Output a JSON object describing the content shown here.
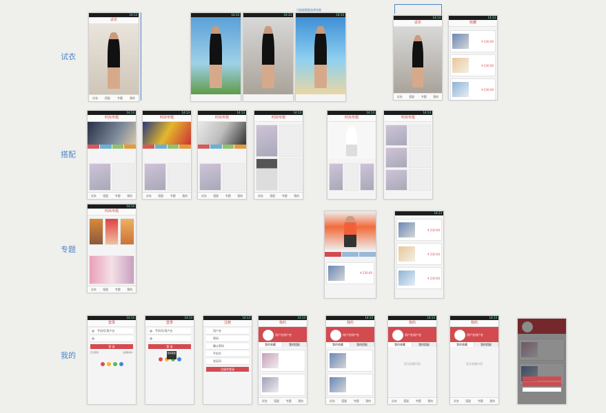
{
  "rows": [
    {
      "label": "试衣"
    },
    {
      "label": "搭配"
    },
    {
      "label": "专题"
    },
    {
      "label": "我的"
    }
  ],
  "statusbar": {
    "time": "14:13"
  },
  "tabbar": [
    "试衣",
    "搭配",
    "专题",
    "我的"
  ],
  "titles": {
    "tryon": "试衣",
    "fav": "收藏",
    "match": "时尚专题",
    "login": "登录",
    "register": "注册",
    "mine": "我的"
  },
  "notes": {
    "scene_switch": "可根据需要选择场景"
  },
  "login": {
    "user_placeholder": "手机号/用户名",
    "login_btn": "登 录",
    "forgot": "忘记密码",
    "register": "注册新用户",
    "toast": "密码错误"
  },
  "register": {
    "fields": [
      "用户名",
      "密码",
      "确认密码",
      "手机号",
      "验证码"
    ],
    "submit_btn": "注册并登录"
  },
  "mine": {
    "user_name": "用户名用户名",
    "tabs": [
      "我的收藏",
      "我的搭配"
    ],
    "empty_text": "暂无收藏内容"
  },
  "products": {
    "price": "¥ 230.00"
  },
  "colors": {
    "accent": "#d34a4f",
    "note_blue": "#4a86c8"
  }
}
